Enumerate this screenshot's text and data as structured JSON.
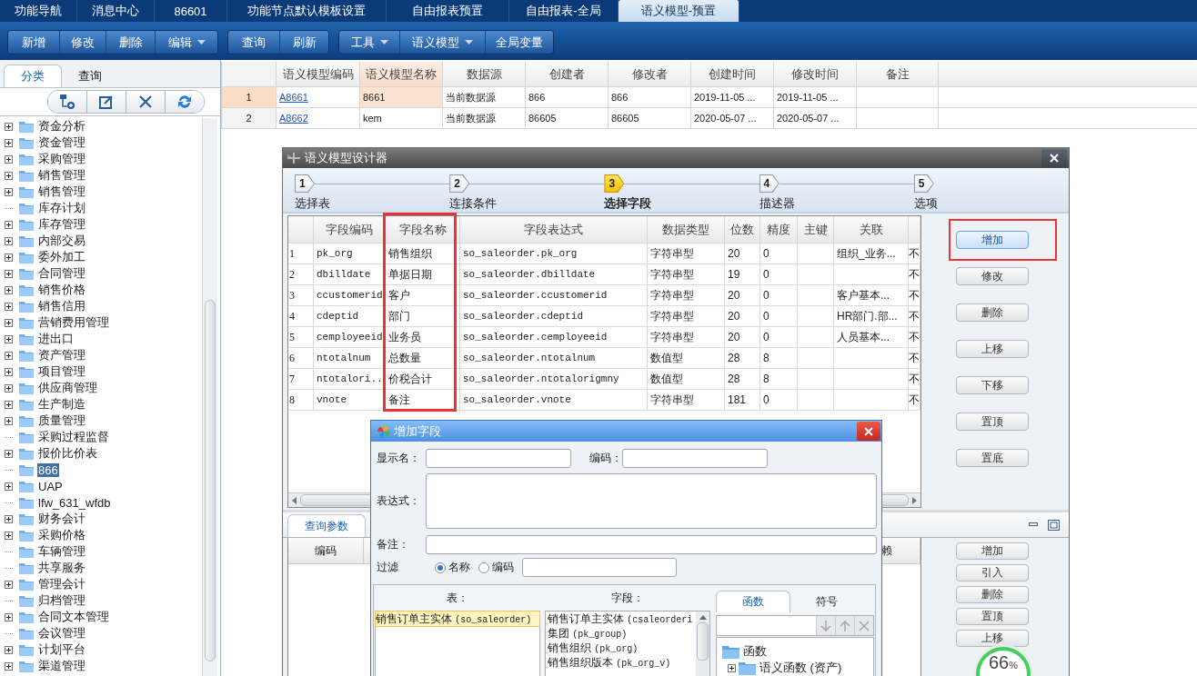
{
  "top_tabs": [
    {
      "label": "功能导航",
      "selected": false
    },
    {
      "label": "消息中心",
      "selected": false
    },
    {
      "label": "86601",
      "selected": false
    },
    {
      "label": "功能节点默认模板设置",
      "selected": false
    },
    {
      "label": "自由报表预置",
      "selected": false
    },
    {
      "label": "自由报表-全局",
      "selected": false
    },
    {
      "label": "语义模型-预置",
      "selected": true
    }
  ],
  "toolbar": [
    {
      "buttons": [
        {
          "label": "新增",
          "dropdown": false
        },
        {
          "label": "修改",
          "dropdown": false
        },
        {
          "label": "删除",
          "dropdown": false
        },
        {
          "label": "编辑",
          "dropdown": true
        }
      ]
    },
    {
      "buttons": [
        {
          "label": "查询",
          "dropdown": false
        },
        {
          "label": "刷新",
          "dropdown": false
        }
      ]
    },
    {
      "buttons": [
        {
          "label": "工具",
          "dropdown": true
        },
        {
          "label": "语义模型",
          "dropdown": true
        },
        {
          "label": "全局变量",
          "dropdown": false
        }
      ]
    }
  ],
  "sidebar": {
    "tabs": [
      {
        "label": "分类",
        "selected": true
      },
      {
        "label": "查询",
        "selected": false
      }
    ],
    "tree": [
      {
        "label": "资金分析",
        "expandable": true,
        "selected": false
      },
      {
        "label": "资金管理",
        "expandable": true,
        "selected": false
      },
      {
        "label": "采购管理",
        "expandable": true,
        "selected": false
      },
      {
        "label": "销售管理",
        "expandable": true,
        "selected": false
      },
      {
        "label": "销售管理",
        "expandable": true,
        "selected": false
      },
      {
        "label": "库存计划",
        "expandable": false,
        "selected": false
      },
      {
        "label": "库存管理",
        "expandable": true,
        "selected": false
      },
      {
        "label": "内部交易",
        "expandable": true,
        "selected": false
      },
      {
        "label": "委外加工",
        "expandable": true,
        "selected": false
      },
      {
        "label": "合同管理",
        "expandable": true,
        "selected": false
      },
      {
        "label": "销售价格",
        "expandable": true,
        "selected": false
      },
      {
        "label": "销售信用",
        "expandable": true,
        "selected": false
      },
      {
        "label": "营销费用管理",
        "expandable": true,
        "selected": false
      },
      {
        "label": "进出口",
        "expandable": true,
        "selected": false
      },
      {
        "label": "资产管理",
        "expandable": true,
        "selected": false
      },
      {
        "label": "项目管理",
        "expandable": true,
        "selected": false
      },
      {
        "label": "供应商管理",
        "expandable": true,
        "selected": false
      },
      {
        "label": "生产制造",
        "expandable": true,
        "selected": false
      },
      {
        "label": "质量管理",
        "expandable": true,
        "selected": false
      },
      {
        "label": "采购过程监督",
        "expandable": false,
        "selected": false
      },
      {
        "label": "报价比价表",
        "expandable": true,
        "selected": false
      },
      {
        "label": "866",
        "expandable": false,
        "selected": true
      },
      {
        "label": "UAP",
        "expandable": true,
        "selected": false
      },
      {
        "label": "lfw_631_wfdb",
        "expandable": false,
        "selected": false
      },
      {
        "label": "财务会计",
        "expandable": true,
        "selected": false
      },
      {
        "label": "采购价格",
        "expandable": true,
        "selected": false
      },
      {
        "label": "车辆管理",
        "expandable": false,
        "selected": false
      },
      {
        "label": "共享服务",
        "expandable": false,
        "selected": false
      },
      {
        "label": "管理会计",
        "expandable": true,
        "selected": false
      },
      {
        "label": "归档管理",
        "expandable": false,
        "selected": false
      },
      {
        "label": "合同文本管理",
        "expandable": true,
        "selected": false
      },
      {
        "label": "会议管理",
        "expandable": false,
        "selected": false
      },
      {
        "label": "计划平台",
        "expandable": true,
        "selected": false
      },
      {
        "label": "渠道管理",
        "expandable": true,
        "selected": false
      }
    ]
  },
  "model_table": {
    "columns": [
      {
        "label": "语义模型编码",
        "kind": "link",
        "selected": false
      },
      {
        "label": "语义模型名称",
        "kind": "text",
        "selected": true
      },
      {
        "label": "数据源",
        "kind": "text",
        "selected": false
      },
      {
        "label": "创建者",
        "kind": "text",
        "selected": false
      },
      {
        "label": "修改者",
        "kind": "text",
        "selected": false
      },
      {
        "label": "创建时间",
        "kind": "text",
        "selected": false
      },
      {
        "label": "修改时间",
        "kind": "text",
        "selected": false
      },
      {
        "label": "备注",
        "kind": "text",
        "selected": false
      }
    ],
    "rows": [
      {
        "number": "1",
        "selected": true,
        "cells": [
          "A8661",
          "8661",
          "当前数据源",
          "866",
          "866",
          "2019-11-05 ...",
          "2019-11-05 ..."
        ]
      },
      {
        "number": "2",
        "selected": false,
        "cells": [
          "A8662",
          "kem",
          "当前数据源",
          "86605",
          "86605",
          "2020-05-07 ...",
          "2020-05-07 ..."
        ]
      }
    ]
  },
  "designer_dialog": {
    "title": "语义模型设计器",
    "steps": [
      {
        "number": "1",
        "label": "选择表",
        "current": false
      },
      {
        "number": "2",
        "label": "连接条件",
        "current": false
      },
      {
        "number": "3",
        "label": "选择字段",
        "current": true
      },
      {
        "number": "4",
        "label": "描述器",
        "current": false
      },
      {
        "number": "5",
        "label": "选项",
        "current": false
      }
    ],
    "field_columns": [
      {
        "label": "字段编码",
        "annotated": false
      },
      {
        "label": "字段名称",
        "annotated": true
      },
      {
        "label": "字段表达式",
        "annotated": false
      },
      {
        "label": "数据类型",
        "annotated": false
      },
      {
        "label": "位数",
        "annotated": false
      },
      {
        "label": "精度",
        "annotated": false
      },
      {
        "label": "主键",
        "annotated": false
      },
      {
        "label": "关联",
        "annotated": false
      }
    ],
    "field_rows": [
      {
        "no": "1",
        "code": "pk_org",
        "name": "销售组织",
        "expression": "so_saleorder.pk_org",
        "type": "字符串型",
        "length": "20",
        "precision": "0",
        "relation": "组织_业务...",
        "column_10": "不"
      },
      {
        "no": "2",
        "code": "dbilldate",
        "name": "单据日期",
        "expression": "so_saleorder.dbilldate",
        "type": "字符串型",
        "length": "19",
        "precision": "0",
        "column_10": "不"
      },
      {
        "no": "3",
        "code": "ccustomerid",
        "name": "客户",
        "expression": "so_saleorder.ccustomerid",
        "type": "字符串型",
        "length": "20",
        "precision": "0",
        "relation": "客户基本...",
        "column_10": "不"
      },
      {
        "no": "4",
        "code": "cdeptid",
        "name": "部门",
        "expression": "so_saleorder.cdeptid",
        "type": "字符串型",
        "length": "20",
        "precision": "0",
        "relation": "HR部门.部...",
        "column_10": "不"
      },
      {
        "no": "5",
        "code": "cemployeeid",
        "name": "业务员",
        "expression": "so_saleorder.cemployeeid",
        "type": "字符串型",
        "length": "20",
        "precision": "0",
        "relation": "人员基本...",
        "column_10": "不"
      },
      {
        "no": "6",
        "code": "ntotalnum",
        "name": "总数量",
        "expression": "so_saleorder.ntotalnum",
        "type": "数值型",
        "length": "28",
        "precision": "8",
        "column_10": "不"
      },
      {
        "no": "7",
        "code": "ntotalori...",
        "name": "价税合计",
        "expression": "so_saleorder.ntotalorigmny",
        "type": "数值型",
        "length": "28",
        "precision": "8",
        "column_10": "不"
      },
      {
        "no": "8",
        "code": "vnote",
        "name": "备注",
        "expression": "so_saleorder.vnote",
        "type": "字符串型",
        "length": "181",
        "precision": "0",
        "column_10": "不"
      }
    ],
    "buttons": [
      {
        "label": "增加",
        "focused": true,
        "annotated": true
      },
      {
        "label": "修改",
        "focused": false,
        "annotated": false
      },
      {
        "label": "删除",
        "focused": false,
        "annotated": false
      },
      {
        "label": "上移",
        "focused": false,
        "annotated": false
      },
      {
        "label": "下移",
        "focused": false,
        "annotated": false
      },
      {
        "label": "置顶",
        "focused": false,
        "annotated": false
      },
      {
        "label": "置底",
        "focused": false,
        "annotated": false
      }
    ],
    "params_panel": {
      "tabs": [
        {
          "label": "查询参数",
          "selected": true
        }
      ],
      "columns": [
        {
          "label": "编码"
        },
        {
          "label": "赖"
        }
      ],
      "buttons": [
        {
          "label": "增加"
        },
        {
          "label": "引入"
        },
        {
          "label": "删除"
        },
        {
          "label": "置顶"
        },
        {
          "label": "上移"
        }
      ]
    }
  },
  "add_field_dialog": {
    "title": "增加字段",
    "name_label": "显示名：",
    "code_label": "编码：",
    "expression_label": "表达式：",
    "note_label": "备注：",
    "filter": {
      "label": "过滤",
      "options": [
        {
          "label": "名称",
          "selected": true
        },
        {
          "label": "编码",
          "selected": false
        }
      ]
    },
    "table_header": "表：",
    "field_header": "字段：",
    "tables": [
      {
        "name": "销售订单主实体",
        "code": "(so_saleorder)",
        "selected": true
      }
    ],
    "fields": [
      {
        "name": "销售订单主实体",
        "code": "(csaleorderi"
      },
      {
        "name": "集团",
        "code": "(pk_group)"
      },
      {
        "name": "销售组织",
        "code": "(pk_org)"
      },
      {
        "name": "销售组织版本",
        "code": "(pk_org_v)"
      }
    ],
    "function_tabs": [
      {
        "label": "函数",
        "selected": true
      },
      {
        "label": "符号",
        "selected": false
      }
    ],
    "function_tree": [
      {
        "label": "函数",
        "expanded": true,
        "children": [
          {
            "label": "语义函数 (资产)",
            "expanded": false
          }
        ]
      }
    ]
  },
  "memory_badge": {
    "value": "66",
    "unit": "%"
  }
}
